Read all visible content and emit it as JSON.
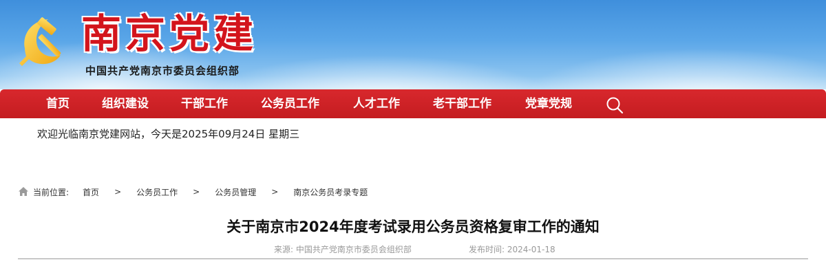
{
  "header": {
    "site_title": "南京党建",
    "site_subtitle": "中国共产党南京市委员会组织部",
    "emblem_icon": "party-emblem-icon",
    "title_color": "#d3141c"
  },
  "nav": {
    "background": "#c8201f",
    "items": [
      {
        "label": "首页"
      },
      {
        "label": "组织建设"
      },
      {
        "label": "干部工作"
      },
      {
        "label": "公务员工作"
      },
      {
        "label": "人才工作"
      },
      {
        "label": "老干部工作"
      },
      {
        "label": "党章党规"
      }
    ],
    "search_icon": "search-icon"
  },
  "welcome": {
    "text": "欢迎光临南京党建网站，今天是2025年09月24日 星期三"
  },
  "breadcrumb": {
    "home_icon": "home-icon",
    "label": "当前位置:",
    "items": [
      "首页",
      "公务员工作",
      "公务员管理",
      "南京公务员考录专题"
    ],
    "separator": ">"
  },
  "article": {
    "title": "关于南京市2024年度考试录用公务员资格复审工作的通知",
    "source": "来源: 中国共产党南京市委员会组织部",
    "date": "发布时间: 2024-01-18"
  }
}
